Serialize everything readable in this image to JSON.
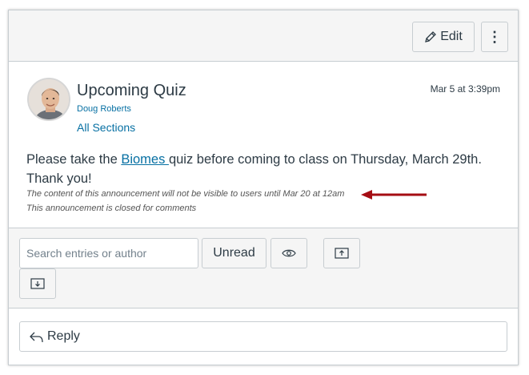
{
  "toolbar": {
    "edit_label": "Edit",
    "more_label": "⋮"
  },
  "announcement": {
    "title": "Upcoming Quiz",
    "author": "Doug Roberts",
    "sections": "All Sections",
    "posted_at": "Mar 5 at 3:39pm",
    "body_prefix": "Please take the ",
    "body_link": "Biomes ",
    "body_suffix": "quiz before coming to class on Thursday, March 29th. Thank you!",
    "visibility_note": "The content of this announcement will not be visible to users until Mar 20 at 12am",
    "comments_note": "This announcement is closed for comments"
  },
  "annotation": {
    "arrow_color": "#a50d13"
  },
  "filters": {
    "search_placeholder": "Search entries or author",
    "unread_label": "Unread"
  },
  "reply": {
    "label": "Reply"
  },
  "colors": {
    "link": "#0770a3",
    "text": "#2d3b45",
    "border": "#c7cdd1",
    "panel_bg": "#f5f5f5"
  }
}
